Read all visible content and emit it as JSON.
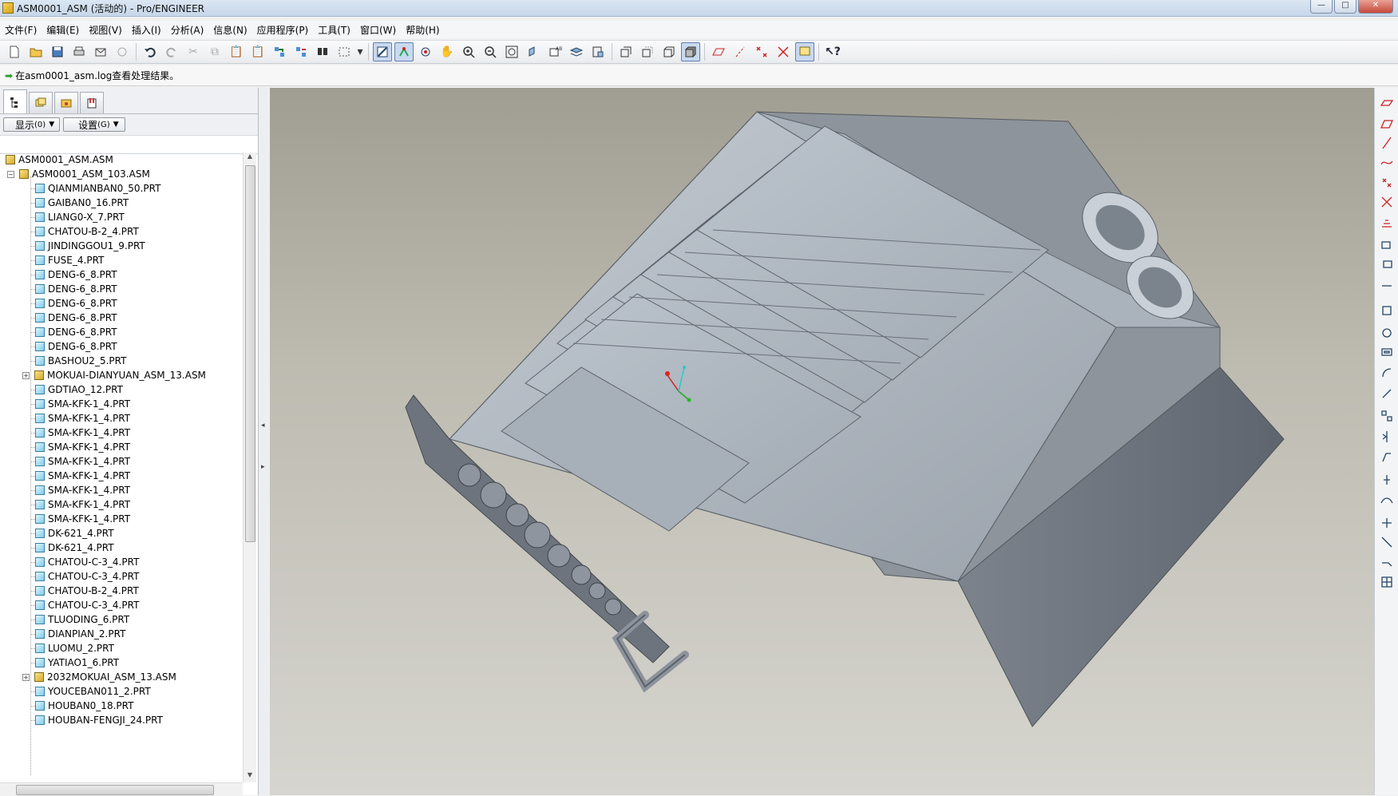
{
  "window": {
    "title": "ASM0001_ASM (活动的) - Pro/ENGINEER"
  },
  "menu": [
    "文件(F)",
    "编辑(E)",
    "视图(V)",
    "插入(I)",
    "分析(A)",
    "信息(N)",
    "应用程序(P)",
    "工具(T)",
    "窗口(W)",
    "帮助(H)"
  ],
  "message": "在asm0001_asm.log查看处理结果。",
  "navigator": {
    "show_label": "显示",
    "show_hotkey": "(0)",
    "settings_label": "设置",
    "settings_hotkey": "(G)"
  },
  "tree": {
    "root": "ASM0001_ASM.ASM",
    "sub": "ASM0001_ASM_103.ASM",
    "items": [
      {
        "label": "QIANMIANBAN0_50.PRT",
        "type": "prt"
      },
      {
        "label": "GAIBAN0_16.PRT",
        "type": "prt"
      },
      {
        "label": "LIANG0-X_7.PRT",
        "type": "prt"
      },
      {
        "label": "CHATOU-B-2_4.PRT",
        "type": "prt"
      },
      {
        "label": "JINDINGGOU1_9.PRT",
        "type": "prt"
      },
      {
        "label": "FUSE_4.PRT",
        "type": "prt"
      },
      {
        "label": "DENG-6_8.PRT",
        "type": "prt"
      },
      {
        "label": "DENG-6_8.PRT",
        "type": "prt"
      },
      {
        "label": "DENG-6_8.PRT",
        "type": "prt"
      },
      {
        "label": "DENG-6_8.PRT",
        "type": "prt"
      },
      {
        "label": "DENG-6_8.PRT",
        "type": "prt"
      },
      {
        "label": "DENG-6_8.PRT",
        "type": "prt"
      },
      {
        "label": "BASHOU2_5.PRT",
        "type": "prt"
      },
      {
        "label": "MOKUAI-DIANYUAN_ASM_13.ASM",
        "type": "asm"
      },
      {
        "label": "GDTIAO_12.PRT",
        "type": "prt"
      },
      {
        "label": "SMA-KFK-1_4.PRT",
        "type": "prt"
      },
      {
        "label": "SMA-KFK-1_4.PRT",
        "type": "prt"
      },
      {
        "label": "SMA-KFK-1_4.PRT",
        "type": "prt"
      },
      {
        "label": "SMA-KFK-1_4.PRT",
        "type": "prt"
      },
      {
        "label": "SMA-KFK-1_4.PRT",
        "type": "prt"
      },
      {
        "label": "SMA-KFK-1_4.PRT",
        "type": "prt"
      },
      {
        "label": "SMA-KFK-1_4.PRT",
        "type": "prt"
      },
      {
        "label": "SMA-KFK-1_4.PRT",
        "type": "prt"
      },
      {
        "label": "SMA-KFK-1_4.PRT",
        "type": "prt"
      },
      {
        "label": "DK-621_4.PRT",
        "type": "prt"
      },
      {
        "label": "DK-621_4.PRT",
        "type": "prt"
      },
      {
        "label": "CHATOU-C-3_4.PRT",
        "type": "prt"
      },
      {
        "label": "CHATOU-C-3_4.PRT",
        "type": "prt"
      },
      {
        "label": "CHATOU-B-2_4.PRT",
        "type": "prt"
      },
      {
        "label": "CHATOU-C-3_4.PRT",
        "type": "prt"
      },
      {
        "label": "TLUODING_6.PRT",
        "type": "prt"
      },
      {
        "label": "DIANPIAN_2.PRT",
        "type": "prt"
      },
      {
        "label": "LUOMU_2.PRT",
        "type": "prt"
      },
      {
        "label": "YATIAO1_6.PRT",
        "type": "prt"
      },
      {
        "label": "2032MOKUAI_ASM_13.ASM",
        "type": "asm"
      },
      {
        "label": "YOUCEBAN011_2.PRT",
        "type": "prt"
      },
      {
        "label": "HOUBAN0_18.PRT",
        "type": "prt"
      },
      {
        "label": "HOUBAN-FENGJI_24.PRT",
        "type": "prt"
      }
    ]
  },
  "colors": {
    "model": "#9ba2ab",
    "background_top": "#a09e92",
    "background_bottom": "#d6d5cf"
  }
}
